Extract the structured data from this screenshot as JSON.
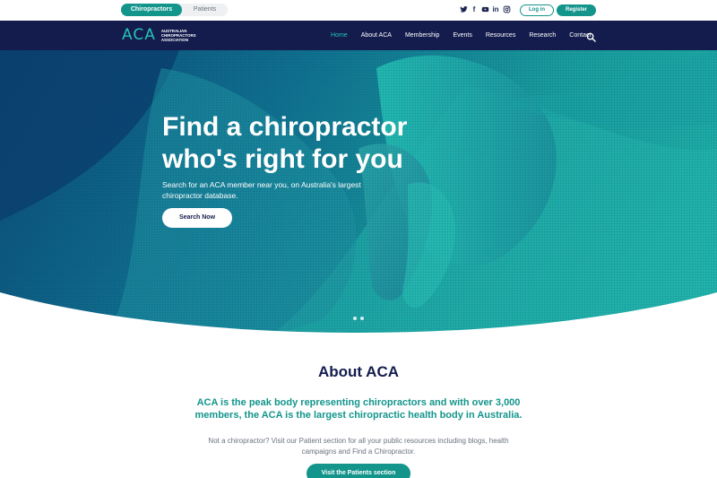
{
  "utility": {
    "audience_tabs": [
      {
        "label": "Chiropractors",
        "active": true
      },
      {
        "label": "Patients",
        "active": false
      }
    ],
    "social_icons": [
      "twitter-icon",
      "facebook-icon",
      "youtube-icon",
      "linkedin-icon",
      "instagram-icon"
    ],
    "social_glyphs": [
      "🐦",
      "f",
      "▶",
      "in",
      "◎"
    ],
    "login_label": "Log in",
    "register_label": "Register"
  },
  "nav": {
    "logo_mark": "ACA",
    "logo_text": "AUSTRALIAN CHIROPRACTORS ASSOCIATION",
    "items": [
      "Home",
      "About ACA",
      "Membership",
      "Events",
      "Resources",
      "Research",
      "Contact"
    ],
    "active_index": 0
  },
  "hero": {
    "title": "Find a chiropractor who's right for you",
    "subtitle": "Search for an ACA member near you, on Australia's largest chiropractor database.",
    "button_label": "Search Now",
    "slide_count": 2,
    "active_slide": 0
  },
  "about": {
    "title": "About ACA",
    "lead": "ACA is the peak body representing chiropractors and with over 3,000 members, the ACA is the largest chiropractic health body in Australia.",
    "body": "Not a chiropractor? Visit our Patient section for all your public resources including blogs, health campaigns and Find a Chiropractor.",
    "button_label": "Visit the Patients section"
  },
  "colors": {
    "navy": "#131c4d",
    "teal": "#13958c",
    "accent": "#27c3b6"
  }
}
